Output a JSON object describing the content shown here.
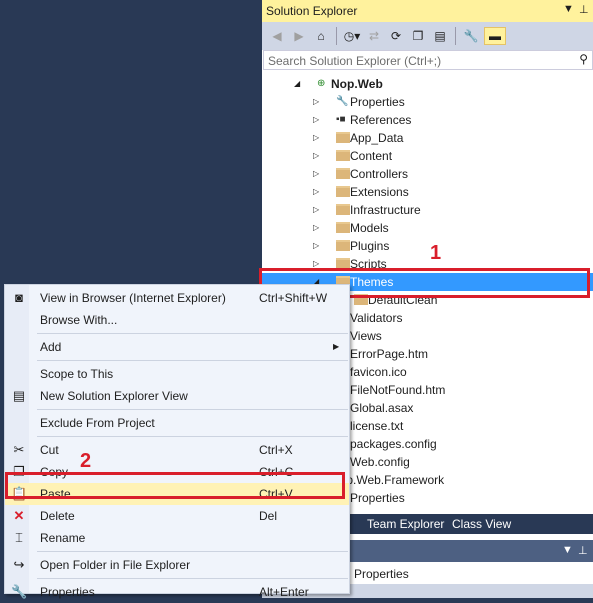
{
  "solution_explorer": {
    "title": "Solution Explorer",
    "search_placeholder": "Search Solution Explorer (Ctrl+;)",
    "toolbar_icons": [
      "back-icon",
      "forward-icon",
      "home-icon",
      "history-icon",
      "sync-icon",
      "refresh-icon",
      "collapse-all-icon",
      "show-all-files-icon",
      "properties-wrench-icon",
      "preview-icon"
    ],
    "tree": [
      {
        "label": "Nop.Web",
        "level": 0,
        "expanded": true,
        "icon": "web-project-icon",
        "bold": true
      },
      {
        "label": "Properties",
        "level": 1,
        "icon": "wrench-icon"
      },
      {
        "label": "References",
        "level": 1,
        "icon": "references-icon"
      },
      {
        "label": "App_Data",
        "level": 1,
        "icon": "folder-icon"
      },
      {
        "label": "Content",
        "level": 1,
        "icon": "folder-icon"
      },
      {
        "label": "Controllers",
        "level": 1,
        "icon": "folder-icon"
      },
      {
        "label": "Extensions",
        "level": 1,
        "icon": "folder-icon"
      },
      {
        "label": "Infrastructure",
        "level": 1,
        "icon": "folder-icon"
      },
      {
        "label": "Models",
        "level": 1,
        "icon": "folder-icon"
      },
      {
        "label": "Plugins",
        "level": 1,
        "icon": "folder-icon"
      },
      {
        "label": "Scripts",
        "level": 1,
        "icon": "folder-icon"
      },
      {
        "label": "Themes",
        "level": 1,
        "icon": "folder-icon",
        "expanded": true,
        "selected": true
      },
      {
        "label": "DefaultClean",
        "level": 2,
        "icon": "folder-icon"
      },
      {
        "label": "Validators",
        "level": 1,
        "icon": "folder-icon"
      },
      {
        "label": "Views",
        "level": 1,
        "icon": "folder-icon"
      },
      {
        "label": "ErrorPage.htm",
        "level": 1,
        "icon": "file-icon"
      },
      {
        "label": "favicon.ico",
        "level": 1,
        "icon": "file-icon"
      },
      {
        "label": "FileNotFound.htm",
        "level": 1,
        "icon": "file-icon"
      },
      {
        "label": "Global.asax",
        "level": 1,
        "icon": "file-icon"
      },
      {
        "label": "license.txt",
        "level": 1,
        "icon": "file-icon"
      },
      {
        "label": "packages.config",
        "level": 1,
        "icon": "file-icon"
      },
      {
        "label": "Web.config",
        "level": 1,
        "icon": "file-icon"
      },
      {
        "label": "Nop.Web.Framework",
        "level": 0,
        "icon": "project-icon"
      },
      {
        "label": "Properties",
        "level": 1,
        "icon": "wrench-icon"
      }
    ]
  },
  "bottom_tabs": [
    {
      "label": "r",
      "active": true
    },
    {
      "label": "Team Explorer"
    },
    {
      "label": "Class View"
    }
  ],
  "properties_panel": {
    "row_label": "Properties"
  },
  "context_menu": {
    "items": [
      {
        "label": "View in Browser (Internet Explorer)",
        "shortcut": "Ctrl+Shift+W",
        "icon": "view-in-browser-icon"
      },
      {
        "label": "Browse With...",
        "shortcut": ""
      },
      {
        "separator": true
      },
      {
        "label": "Add",
        "shortcut": "",
        "submenu": true
      },
      {
        "separator": true
      },
      {
        "label": "Scope to This",
        "shortcut": ""
      },
      {
        "label": "New Solution Explorer View",
        "shortcut": "",
        "icon": "new-view-icon"
      },
      {
        "separator": true
      },
      {
        "label": "Exclude From Project",
        "shortcut": ""
      },
      {
        "separator": true
      },
      {
        "label": "Cut",
        "shortcut": "Ctrl+X",
        "icon": "cut-icon"
      },
      {
        "label": "Copy",
        "shortcut": "Ctrl+C",
        "icon": "copy-icon"
      },
      {
        "label": "Paste",
        "shortcut": "Ctrl+V",
        "icon": "paste-icon",
        "highlighted": true
      },
      {
        "label": "Delete",
        "shortcut": "Del",
        "icon": "delete-icon"
      },
      {
        "label": "Rename",
        "shortcut": "",
        "icon": "rename-icon"
      },
      {
        "separator": true
      },
      {
        "label": "Open Folder in File Explorer",
        "shortcut": "",
        "icon": "open-folder-icon"
      },
      {
        "separator": true
      },
      {
        "label": "Properties",
        "shortcut": "Alt+Enter",
        "icon": "wrench-icon"
      }
    ]
  },
  "annotations": [
    {
      "label": "1"
    },
    {
      "label": "2"
    }
  ],
  "colors": {
    "accent_selection": "#3399ff",
    "title_yellow": "#fff29d",
    "annotation_red": "#d91e2b",
    "background": "#293955"
  }
}
